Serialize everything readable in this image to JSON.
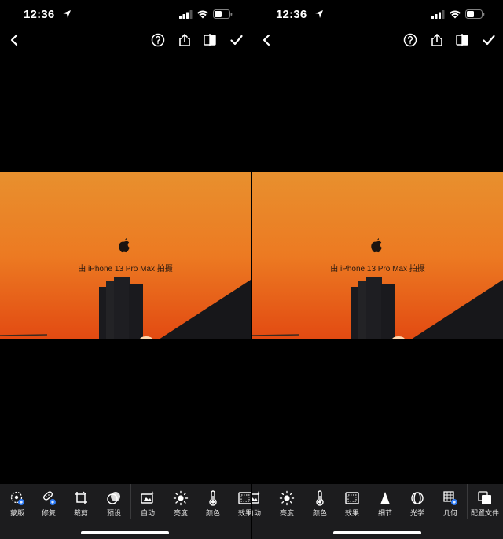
{
  "screens": [
    {
      "status_time": "12:36",
      "caption": "由 iPhone 13 Pro Max 拍摄",
      "tools": [
        {
          "label": "蒙版",
          "icon": "mask-icon"
        },
        {
          "label": "修复",
          "icon": "healing-icon"
        },
        {
          "label": "裁剪",
          "icon": "crop-icon"
        },
        {
          "label": "预设",
          "icon": "presets-icon"
        },
        {
          "label": "自动",
          "icon": "auto-icon"
        },
        {
          "label": "亮度",
          "icon": "brightness-icon"
        },
        {
          "label": "颜色",
          "icon": "color-icon"
        },
        {
          "label": "效果",
          "icon": "effects-icon"
        }
      ]
    },
    {
      "status_time": "12:36",
      "caption": "由 iPhone 13 Pro Max 拍摄",
      "tools": [
        {
          "label": "自动",
          "icon": "auto-icon"
        },
        {
          "label": "亮度",
          "icon": "brightness-icon"
        },
        {
          "label": "颜色",
          "icon": "color-icon"
        },
        {
          "label": "效果",
          "icon": "effects-icon"
        },
        {
          "label": "细节",
          "icon": "detail-icon"
        },
        {
          "label": "光学",
          "icon": "optics-icon"
        },
        {
          "label": "几何",
          "icon": "geometry-icon"
        },
        {
          "label": "配置文件",
          "icon": "profile-icon"
        }
      ]
    }
  ],
  "colors": {
    "sky_top": "#e8902e",
    "sky_bottom": "#e24a12",
    "toolbar_bg": "#1c1c1e",
    "badge_blue": "#2f7cf6"
  }
}
